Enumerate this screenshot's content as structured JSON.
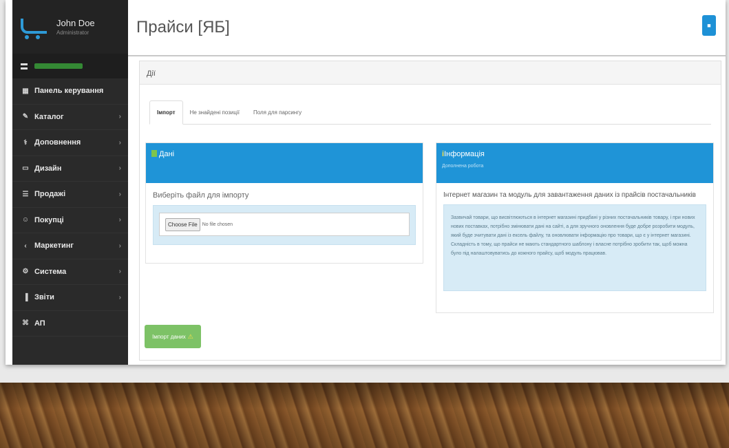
{
  "profile": {
    "name": "John Doe",
    "role": "Administrator"
  },
  "sidebar": {
    "items": [
      {
        "label": "Панель керування",
        "icon": "▦",
        "arrow": ""
      },
      {
        "label": "Каталог",
        "icon": "✎",
        "arrow": "›"
      },
      {
        "label": "Доповнення",
        "icon": "⚕",
        "arrow": "›"
      },
      {
        "label": "Дизайн",
        "icon": "▭",
        "arrow": "›"
      },
      {
        "label": "Продажі",
        "icon": "☰",
        "arrow": "›"
      },
      {
        "label": "Покупці",
        "icon": "☺",
        "arrow": "›"
      },
      {
        "label": "Маркетинг",
        "icon": "‹",
        "arrow": "›"
      },
      {
        "label": "Система",
        "icon": "⚙",
        "arrow": "›"
      },
      {
        "label": "Звіти",
        "icon": "▐",
        "arrow": "›"
      },
      {
        "label": "АП",
        "icon": "⌘",
        "arrow": ""
      }
    ]
  },
  "page": {
    "title": "Прайси [ЯБ]"
  },
  "panel": {
    "heading": "Дії"
  },
  "tabs": [
    {
      "label": "Імпорт"
    },
    {
      "label": "Не знайдені позиції"
    },
    {
      "label": "Поля для парсингу"
    }
  ],
  "data_card": {
    "title": "Дані",
    "subtitle": "Виберіть файл для імпорту",
    "choose_label": "Choose File",
    "no_file": "No file chosen"
  },
  "info_card": {
    "title": "Інформація",
    "sub": "Дополнена робота",
    "heading": "Інтернет магазин та модуль для завантаження даних із прайсів постачальників",
    "text": "Зазвичай товари, що висвітлюються в інтернет магазині придбані у різних постачальників товару, і при нових нових поставках, потрібно змінювати дані на сайті, а для зручного оновлення буде добре розробити модуль, який буде зчитувати дані із ексель файлу, та оновлювати інформацію про товари, що є у інтернет магазині. Складність в тому, що прайси не мають стандартного шаблону і власне потрібно зробити так, щоб можна було під налаштовуватись до кожного прайсу, щоб модуль працював."
  },
  "import_button": {
    "label": "Імпорт даних"
  }
}
